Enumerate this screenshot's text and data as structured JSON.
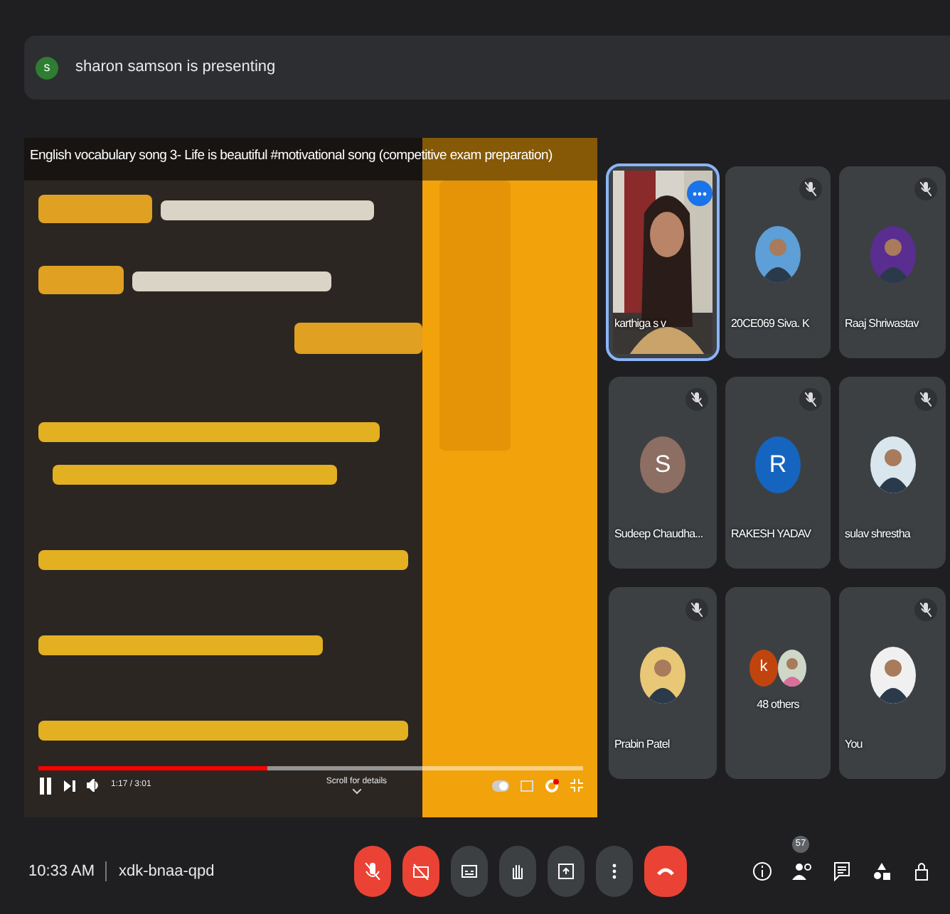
{
  "presenter": {
    "initial": "s",
    "text": "sharon samson is presenting"
  },
  "player": {
    "title": "English vocabulary song 3- Life is beautiful #motivational song (competitive exam preparation)",
    "time": "1:17 / 3:01",
    "hint": "Scroll for details",
    "level": 0.42,
    "playing": true
  },
  "tiles": [
    {
      "name": "karthiga s v",
      "kind": "camera",
      "muted": false,
      "highlighted": true
    },
    {
      "name": "20CE069 Siva. K",
      "muted": true,
      "highlighted": false
    },
    {
      "name": "Raaj Shriwastav",
      "muted": true,
      "highlighted": false
    },
    {
      "name": "Sudeep Chaudha...",
      "kind": "letter",
      "initial": "S",
      "color": "#8d6e63",
      "muted": true,
      "highlighted": false
    },
    {
      "name": "RAKESH YADAV",
      "kind": "letter",
      "initial": "R",
      "color": "#1565c0",
      "muted": true,
      "highlighted": false
    },
    {
      "name": "sulav shrestha",
      "muted": true,
      "highlighted": false
    },
    {
      "name": "Prabin Patel",
      "muted": true,
      "highlighted": false
    },
    {
      "name": "48 others",
      "kind": "group",
      "initial": "k",
      "color": "#c1440e",
      "muted": false,
      "highlighted": false
    },
    {
      "name": "You",
      "muted": true,
      "highlighted": false
    }
  ],
  "footer": {
    "time": "10:33 AM",
    "code": "xdk-bnaa-qpd",
    "controls": [
      {
        "kind": "mic",
        "on": false
      },
      {
        "kind": "camera",
        "on": false
      },
      {
        "kind": "captions"
      },
      {
        "kind": "hand"
      },
      {
        "kind": "present"
      },
      {
        "kind": "more"
      },
      {
        "kind": "leave"
      }
    ],
    "side": [
      {
        "kind": "info"
      },
      {
        "kind": "people",
        "count": "57"
      },
      {
        "kind": "chat"
      },
      {
        "kind": "activities"
      },
      {
        "kind": "lock"
      }
    ]
  }
}
